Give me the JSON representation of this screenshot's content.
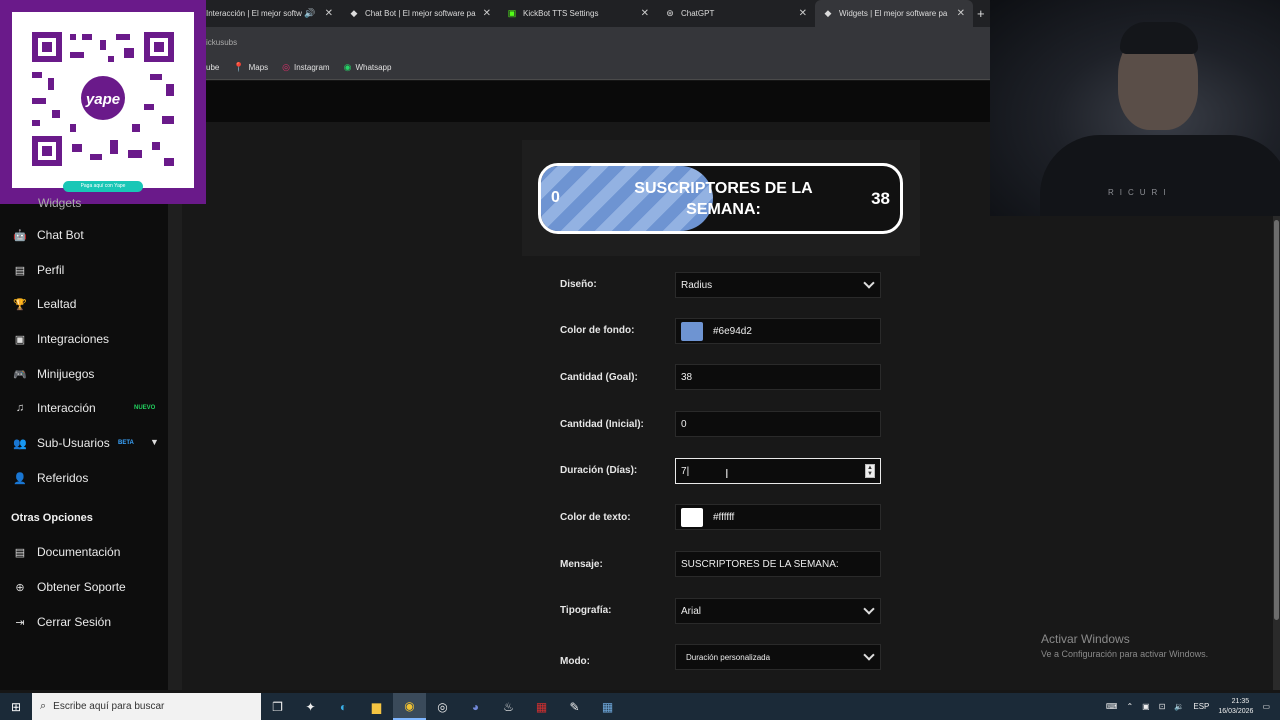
{
  "browser": {
    "tabs": [
      {
        "title": "Interacción | El mejor softw",
        "icon": "speaker-icon"
      },
      {
        "title": "Chat Bot | El mejor software pa",
        "icon": "kickbot-icon"
      },
      {
        "title": "KickBot TTS Settings",
        "icon": "kick-icon"
      },
      {
        "title": "ChatGPT",
        "icon": "chatgpt-icon"
      },
      {
        "title": "Widgets | El mejor software pa",
        "icon": "kickbot-icon"
      }
    ],
    "new_tab": "+",
    "address_partial": "ickusubs",
    "bookmarks": [
      {
        "label": "ube",
        "icon": ""
      },
      {
        "label": "Maps",
        "icon": "maps-icon"
      },
      {
        "label": "Instagram",
        "icon": "instagram-icon"
      },
      {
        "label": "Whatsapp",
        "icon": "whatsapp-icon"
      }
    ]
  },
  "overlay": {
    "qr_caption": "Paga aquí con Yape",
    "qr_brand": "yape",
    "shirt_text": "RICURI"
  },
  "sidebar": {
    "partial_item": "Widgets",
    "items": [
      {
        "label": "Chat Bot",
        "icon": "robot-icon"
      },
      {
        "label": "Perfil",
        "icon": "id-card-icon"
      },
      {
        "label": "Lealtad",
        "icon": "trophy-icon"
      },
      {
        "label": "Integraciones",
        "icon": "plug-icon"
      },
      {
        "label": "Minijuegos",
        "icon": "gamepad-icon"
      },
      {
        "label": "Interacción",
        "icon": "music-note-icon",
        "badge": "NUEVO"
      },
      {
        "label": "Sub-Usuarios",
        "icon": "users-icon",
        "badge": "BETA"
      },
      {
        "label": "Referidos",
        "icon": "user-plus-icon"
      }
    ],
    "section_title": "Otras Opciones",
    "other_items": [
      {
        "label": "Documentación",
        "icon": "document-icon"
      },
      {
        "label": "Obtener Soporte",
        "icon": "support-icon"
      },
      {
        "label": "Cerrar Sesión",
        "icon": "logout-icon"
      }
    ]
  },
  "preview": {
    "start_value": "0",
    "goal_value": "38",
    "message": "SUSCRIPTORES DE LA SEMANA:",
    "fill_color": "#6e94d2",
    "progress_fraction": 0.48
  },
  "form": {
    "diseno_label": "Diseño:",
    "diseno_value": "Radius",
    "color_fondo_label": "Color de fondo:",
    "color_fondo_value": "#6e94d2",
    "goal_label": "Cantidad (Goal):",
    "goal_value": "38",
    "inicial_label": "Cantidad (Inicial):",
    "inicial_value": "0",
    "duracion_label": "Duración (Días):",
    "duracion_value": "7",
    "color_texto_label": "Color de texto:",
    "color_texto_value": "#ffffff",
    "mensaje_label": "Mensaje:",
    "mensaje_value": "SUSCRIPTORES DE LA SEMANA:",
    "tipografia_label": "Tipografía:",
    "tipografia_value": "Arial",
    "modo_label": "Modo:",
    "modo_value": "Duración personalizada"
  },
  "watermark": {
    "line1": "Activar Windows",
    "line2": "Ve a Configuración para activar Windows."
  },
  "taskbar": {
    "search_placeholder": "Escribe aquí para buscar",
    "language": "ESP",
    "time": "21:35",
    "date": "16/03/2026"
  }
}
